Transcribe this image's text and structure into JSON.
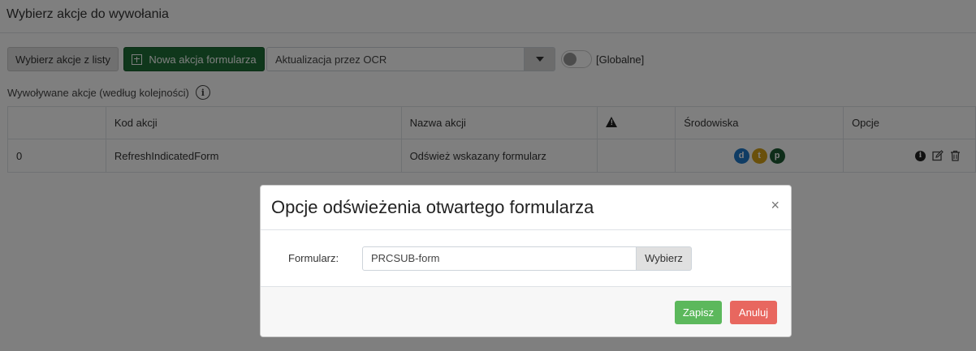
{
  "page": {
    "title": "Wybierz akcje do wywołania"
  },
  "toolbar": {
    "pick_from_list_label": "Wybierz akcje z listy",
    "new_form_action_label": "Nowa akcja formularza",
    "action_select_value": "Aktualizacja przez OCR",
    "global_toggle_label": "[Globalne]",
    "global_toggle_on": false
  },
  "section": {
    "label": "Wywoływane akcje (według kolejności)",
    "info_icon": "info-circle-icon"
  },
  "table": {
    "columns": [
      "",
      "Kod akcji",
      "Nazwa akcji",
      "warning-icon",
      "Środowiska",
      "Opcje"
    ],
    "header": {
      "col0": "",
      "code": "Kod akcji",
      "name": "Nazwa akcji",
      "env": "Środowiska",
      "options": "Opcje"
    },
    "rows": [
      {
        "index": "0",
        "code": "RefreshIndicatedForm",
        "name": "Odśwież wskazany formularz",
        "warning": "",
        "environments": [
          {
            "letter": "d",
            "color": "#1f78c8"
          },
          {
            "letter": "t",
            "color": "#d4a017"
          },
          {
            "letter": "p",
            "color": "#1c5a33"
          }
        ],
        "options_icons": [
          "info-icon",
          "edit-icon",
          "trash-icon"
        ]
      }
    ]
  },
  "modal": {
    "title": "Opcje odświeżenia otwartego formularza",
    "close_label": "×",
    "form_label": "Formularz:",
    "form_value": "PRCSUB-form",
    "pick_label": "Wybierz",
    "save_label": "Zapisz",
    "cancel_label": "Anuluj"
  },
  "colors": {
    "primary_green": "#1e6f36",
    "save": "#5cb85c",
    "cancel": "#e8675f"
  }
}
